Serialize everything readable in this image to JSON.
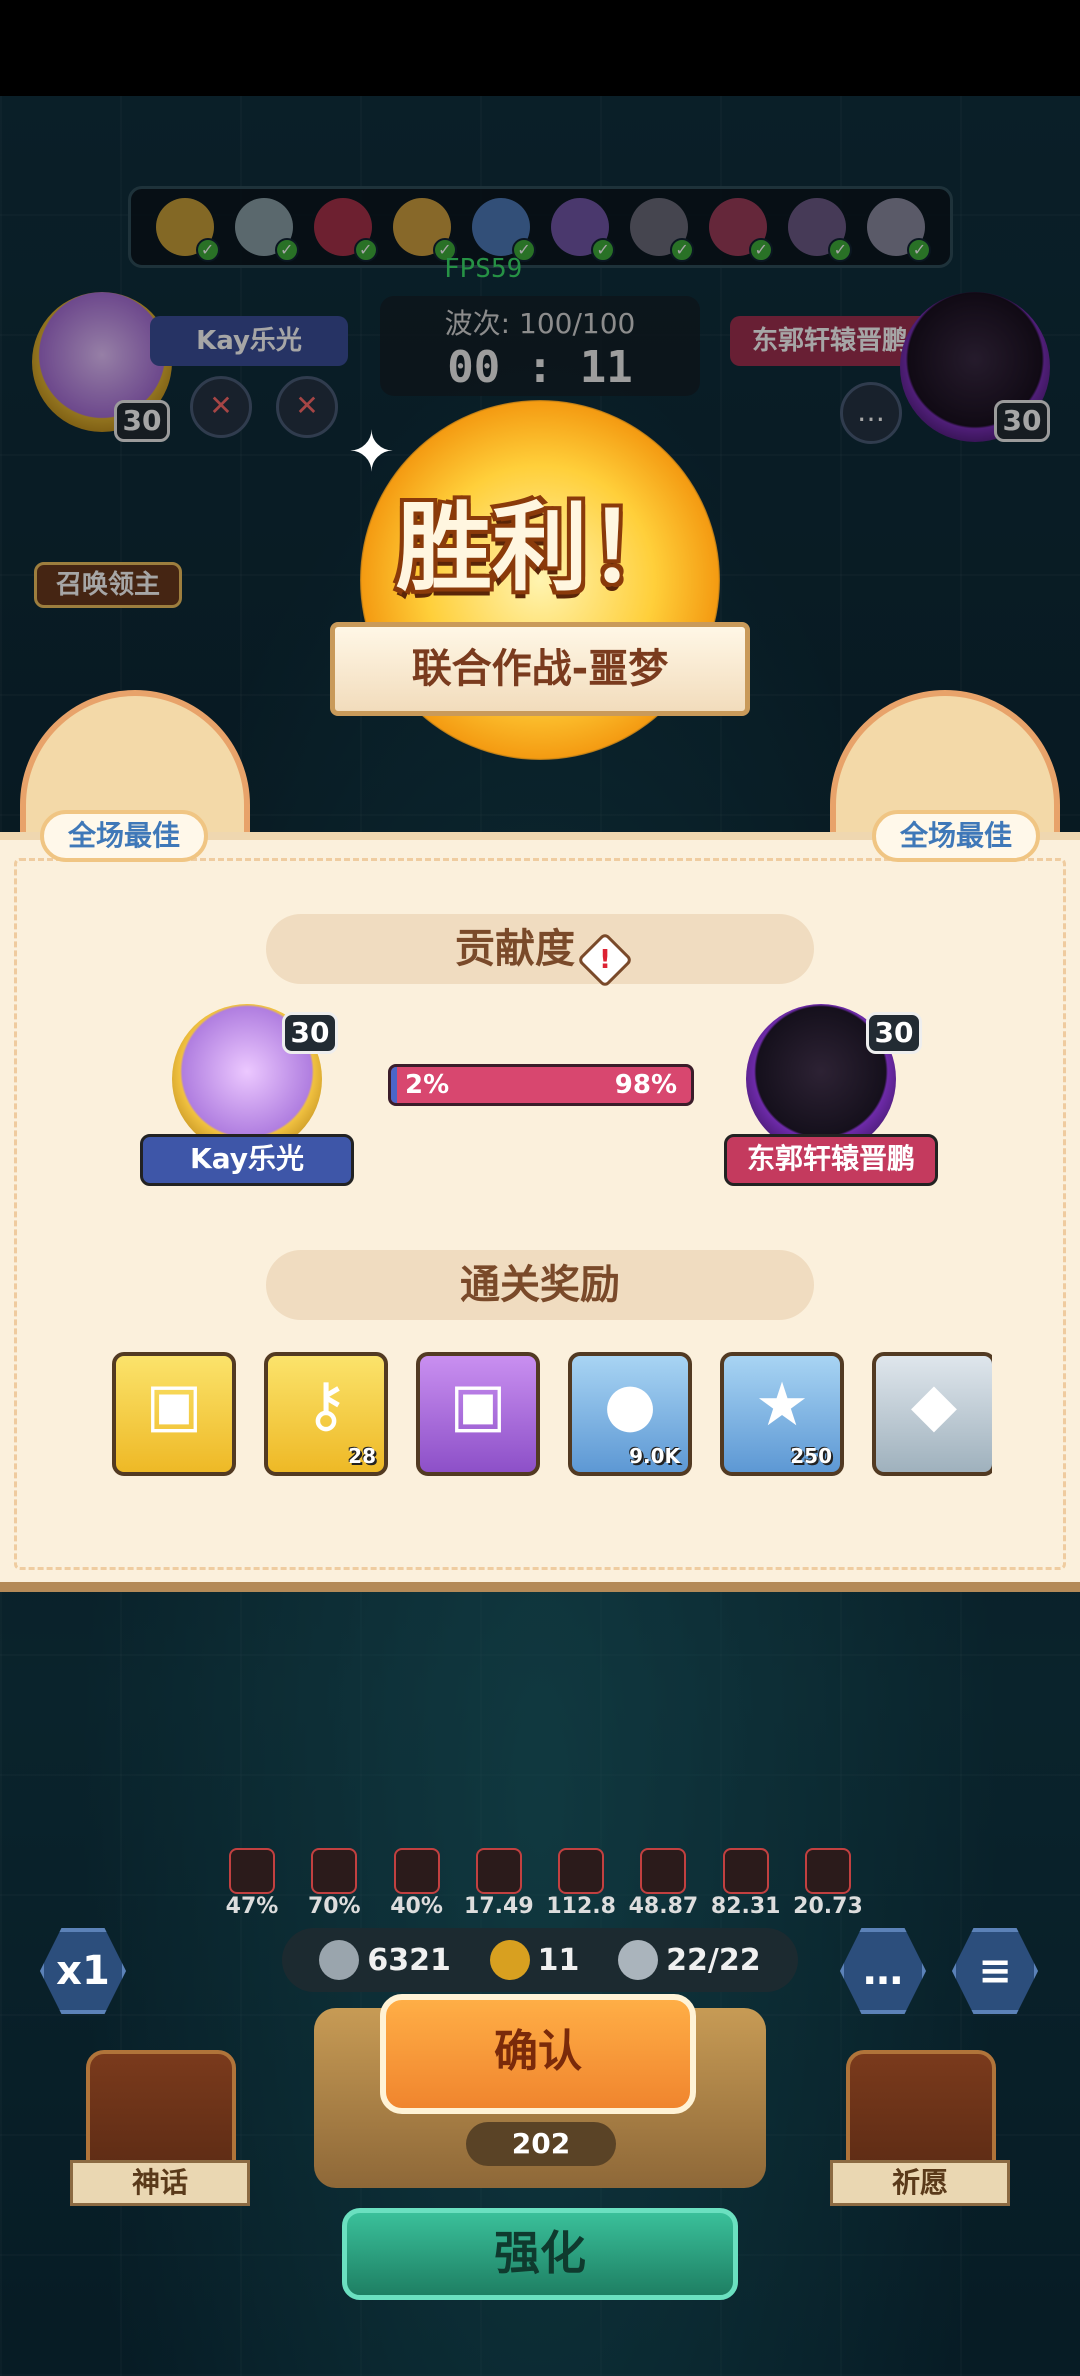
{
  "hud": {
    "fps": "FPS59",
    "wave_label": "波次: 100/100",
    "timer": "00 : 11",
    "summon_label": "召唤领主"
  },
  "players": {
    "left": {
      "name": "Kay乐光",
      "level": "30"
    },
    "right": {
      "name": "东郭轩辕晋鹏",
      "level": "30"
    }
  },
  "victory": {
    "title": "胜利！",
    "mode": "联合作战-噩梦",
    "mvp_left": "全场最佳",
    "mvp_right": "全场最佳"
  },
  "contribution": {
    "header": "贡献度",
    "left_percent": "2%",
    "right_percent": "98%",
    "left_fraction": 0.02
  },
  "rewards": {
    "header": "通关奖励",
    "items": [
      {
        "icon": "gold-chest-icon",
        "count": ""
      },
      {
        "icon": "key-icon",
        "count": "28"
      },
      {
        "icon": "purple-chest-icon",
        "count": ""
      },
      {
        "icon": "gold-coin-icon",
        "count": "9.0K"
      },
      {
        "icon": "trophy-icon",
        "count": "250"
      },
      {
        "icon": "diamond-icon",
        "count": ""
      }
    ]
  },
  "stats": [
    {
      "icon": "spiral-icon",
      "value": "47%"
    },
    {
      "icon": "heart-icon",
      "value": "70%"
    },
    {
      "icon": "skull-icon",
      "value": "40%"
    },
    {
      "icon": "shield-icon",
      "value": "17.49"
    },
    {
      "icon": "burst-icon",
      "value": "112.8"
    },
    {
      "icon": "arrow-up-icon",
      "value": "48.87"
    },
    {
      "icon": "fist-icon",
      "value": "82.31"
    },
    {
      "icon": "refresh-icon",
      "value": "20.73"
    }
  ],
  "resources": {
    "silver": "6321",
    "clover": "11",
    "units": "22/22"
  },
  "controls": {
    "speed": "x1",
    "confirm": "确认",
    "confirm_cost": "202",
    "myth": "神话",
    "pray": "祈愿",
    "upgrade": "强化"
  }
}
